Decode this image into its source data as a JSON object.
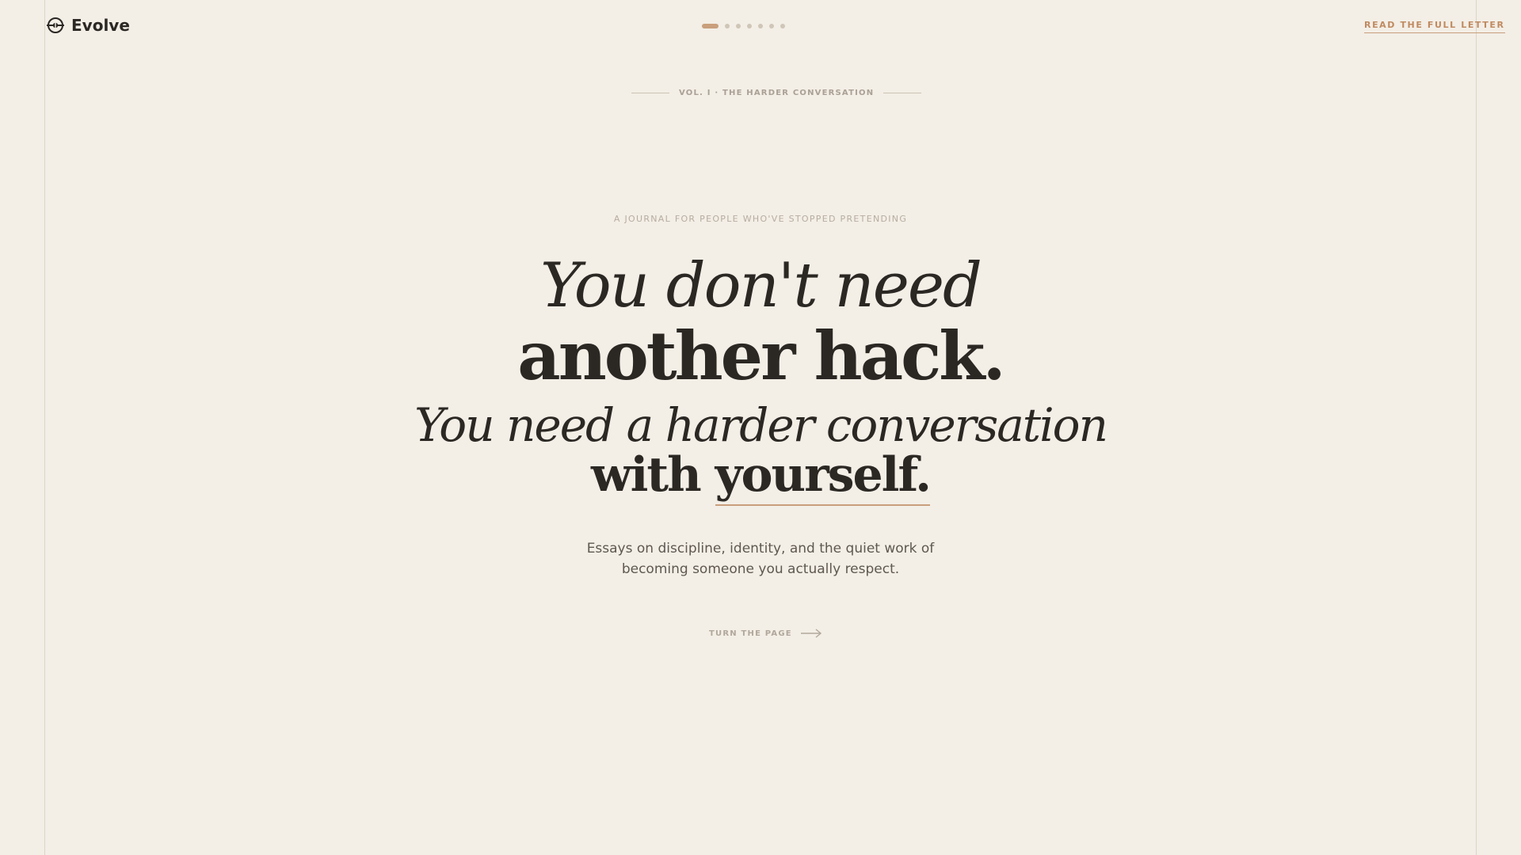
{
  "brand": {
    "name": "Evolve",
    "logo_icon": "compass-icon"
  },
  "pager": {
    "count": 7,
    "active_index": 0
  },
  "header": {
    "read_link_label": "READ THE FULL LETTER"
  },
  "volume": {
    "label": "VOL. I · THE HARDER CONVERSATION"
  },
  "hero": {
    "kicker": "A JOURNAL FOR PEOPLE WHO'VE STOPPED PRETENDING",
    "line1": "You don't need",
    "line2": "another hack.",
    "line3": "You need a harder conversation",
    "line4_prefix": "with",
    "line4_emphasis": "yourself.",
    "lede_line1": "Essays on discipline, identity, and the quiet work of",
    "lede_line2": "becoming someone you actually respect.",
    "cta_label": "TURN THE PAGE",
    "cta_icon": "arrow-right-icon"
  },
  "colors": {
    "background": "#f3eee6",
    "accent": "#c99f7c",
    "ink": "#2b2824"
  }
}
